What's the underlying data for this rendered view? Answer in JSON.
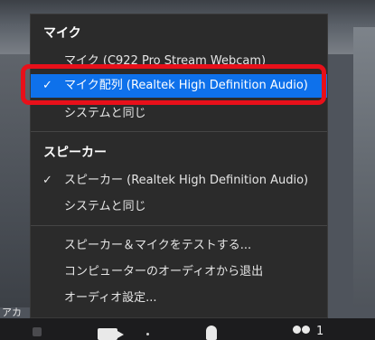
{
  "menu": {
    "microphone_header": "マイク",
    "microphone_items": [
      {
        "label": "マイク (C922 Pro Stream Webcam)",
        "checked": false
      },
      {
        "label": "マイク配列 (Realtek High Definition Audio)",
        "checked": true
      },
      {
        "label": "システムと同じ",
        "checked": false
      }
    ],
    "speaker_header": "スピーカー",
    "speaker_items": [
      {
        "label": "スピーカー (Realtek High Definition Audio)",
        "checked": true
      },
      {
        "label": "システムと同じ",
        "checked": false
      }
    ],
    "actions": [
      {
        "label": "スピーカー＆マイクをテストする..."
      },
      {
        "label": "コンピューターのオーディオから退出"
      },
      {
        "label": "オーディオ設定..."
      }
    ],
    "check_glyph": "✓"
  },
  "side_label": "アカ",
  "toolbar": {
    "participant_count": "1"
  },
  "colors": {
    "menu_bg": "#2b2b2b",
    "selected_bg": "#0e71eb",
    "highlight": "#e8101a"
  }
}
